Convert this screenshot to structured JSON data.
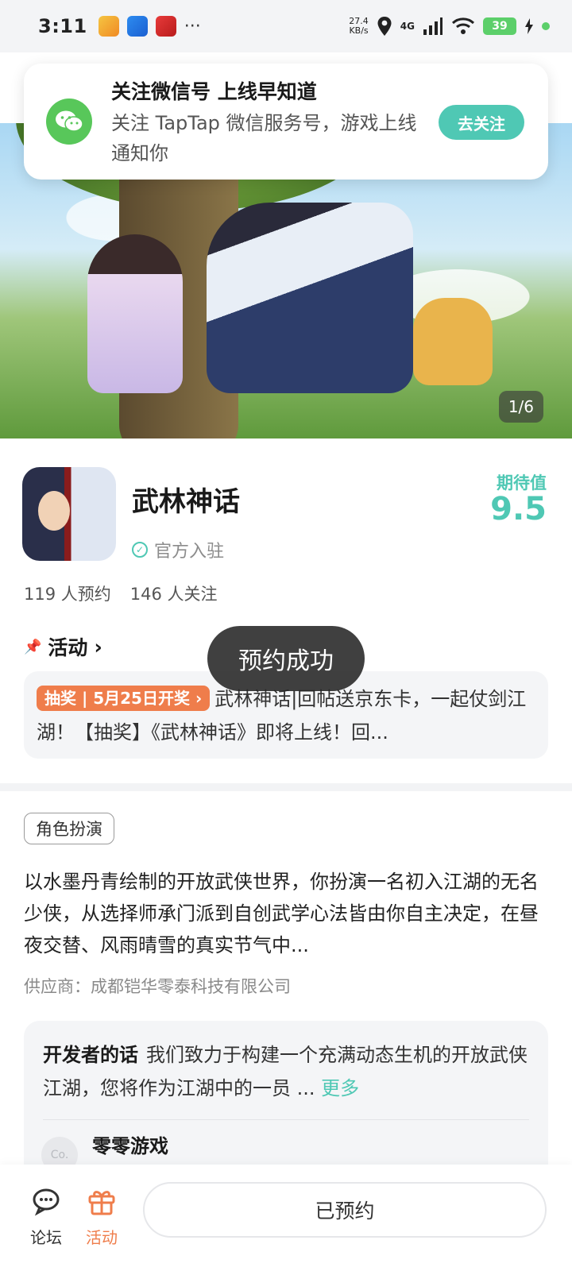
{
  "status_bar": {
    "time": "3:11",
    "net_speed_value": "27.4",
    "net_speed_unit": "KB/s",
    "network": "4G",
    "battery": "39",
    "more": "···"
  },
  "notice": {
    "title": "关注微信号 上线早知道",
    "desc": "关注 TapTap 微信服务号，游戏上线通知你",
    "button": "去关注"
  },
  "hero": {
    "counter": "1/6"
  },
  "game": {
    "name": "武林神话",
    "official": "官方入驻",
    "expect_label": "期待值",
    "expect_value": "9.5",
    "reservations": "119 人预约",
    "followers": "146 人关注"
  },
  "activity": {
    "heading": "活动",
    "tag": "抽奖 | 5月25日开奖",
    "text": "武林神话|回帖送京东卡，一起仗剑江湖！【抽奖】《武林神话》即将上线！回..."
  },
  "toast": "预约成功",
  "details": {
    "genre": "角色扮演",
    "description": "以水墨丹青绘制的开放武侠世界，你扮演一名初入江湖的无名少侠，从选择师承门派到自创武学心法皆由你自主决定，在昼夜交替、风雨晴雪的真实节气中...",
    "supplier": "供应商：成都铠华零泰科技有限公司"
  },
  "developer": {
    "label": "开发者的话",
    "text": "我们致力于构建一个充满动态生机的开放武侠江湖，您将作为江湖中的一员 ...",
    "more": "更多",
    "avatar_text": "Co.",
    "name": "零零游戏"
  },
  "bottom_bar": {
    "forum": "论坛",
    "activity": "活动",
    "reserve_button": "已预约"
  },
  "colors": {
    "accent_teal": "#4fc8b4",
    "accent_orange": "#ef7d4b",
    "wechat_green": "#58c75a"
  }
}
